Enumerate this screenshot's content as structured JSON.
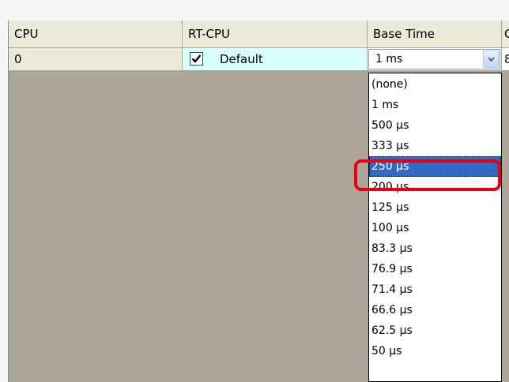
{
  "columns": [
    "CPU",
    "RT-CPU",
    "Base Time",
    "C"
  ],
  "row": {
    "cpu": "0",
    "rt_cpu_checked": true,
    "rt_cpu_label": "Default",
    "base_time_value": "1 ms",
    "next_col_value": "8"
  },
  "dropdown": {
    "options": [
      "(none)",
      "1 ms",
      "500 µs",
      "333 µs",
      "250 µs",
      "200 µs",
      "125 µs",
      "100 µs",
      "83.3 µs",
      "76.9 µs",
      "71.4 µs",
      "66.6 µs",
      "62.5 µs",
      "50 µs"
    ],
    "selected": "250 µs"
  },
  "colors": {
    "grid_background": "#aba697",
    "rt_cell": "#d9fdfd",
    "selection": "#316ac5",
    "annotation": "#e60012"
  },
  "icons": {
    "combo_arrow": "chevron-down-icon",
    "checkbox_mark": "checkmark-icon"
  }
}
